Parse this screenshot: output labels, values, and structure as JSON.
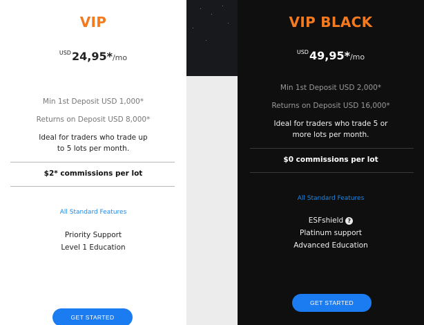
{
  "vip": {
    "title": "VIP",
    "price_currency": "USD",
    "price_amount": "24,95*",
    "price_period": "/mo",
    "min_deposit": "Min 1st Deposit USD 1,000*",
    "returns": "Returns on Deposit USD 8,000*",
    "ideal_line1": "Ideal for traders who trade up",
    "ideal_line2": "to 5 lots per month.",
    "commission": "$2* commissions per lot",
    "features_link": "All Standard Features",
    "features": [
      "Priority Support",
      "Level 1 Education"
    ],
    "cta": "GET STARTED"
  },
  "vip_black": {
    "title": "VIP BLACK",
    "price_currency": "USD",
    "price_amount": "49,95*",
    "price_period": "/mo",
    "min_deposit": "Min 1st Deposit USD 2,000*",
    "returns": "Returns on Deposit USD 16,000*",
    "ideal_line1": "Ideal for traders who trade 5 or",
    "ideal_line2": "more lots per month.",
    "commission": "$0 commissions per lot",
    "features_link": "All Standard Features",
    "features": [
      "ESFshield",
      "Platinum support",
      "Advanced Education"
    ],
    "help_icon": "?",
    "cta": "GET STARTED"
  },
  "colors": {
    "accent_orange": "#f47a20",
    "link_blue": "#1e88e5",
    "button_blue": "#1a7cf0",
    "black_card": "#0f0f10"
  }
}
